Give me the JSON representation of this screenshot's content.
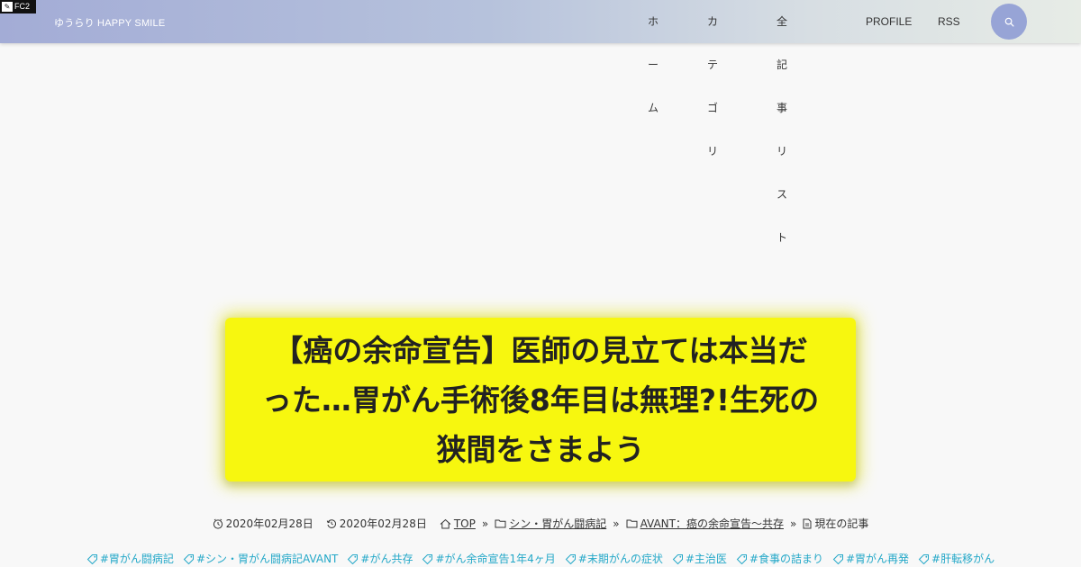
{
  "fc2_badge": "FC2",
  "header": {
    "site_title": "ゆうらり HAPPY SMILE",
    "nav": {
      "home": "ホーム",
      "category": "カテゴリ",
      "all_posts": "全記事リスト",
      "profile": "PROFILE",
      "rss": "RSS"
    },
    "search_icon": "search-icon"
  },
  "article": {
    "title_line1": "【癌の余命宣告】医師の見立ては本当だ",
    "title_line2": "った…胃がん手術後8年目は無理?!生死の",
    "title_line3": "狭間をさまよう"
  },
  "meta": {
    "posted_date": "2020年02月28日",
    "updated_date": "2020年02月28日",
    "breadcrumb": {
      "top": "TOP",
      "category": "シン・胃がん闘病記",
      "subcategory": "AVANT：癌の余命宣告～共存",
      "current": "現在の記事",
      "separator": "»"
    }
  },
  "tags": [
    "#胃がん闘病記",
    "#シン・胃がん闘病記AVANT",
    "#がん共存",
    "#がん余命宣告1年4ヶ月",
    "#末期がんの症状",
    "#主治医",
    "#食事の詰まり",
    "#胃がん再発",
    "#肝転移がん"
  ],
  "colors": {
    "header_gradient_start": "#a3acd6",
    "header_gradient_end": "#e7ece6",
    "title_background": "#f7f70f",
    "tag_color": "#24a8c8",
    "search_button": "#97a4d6"
  }
}
